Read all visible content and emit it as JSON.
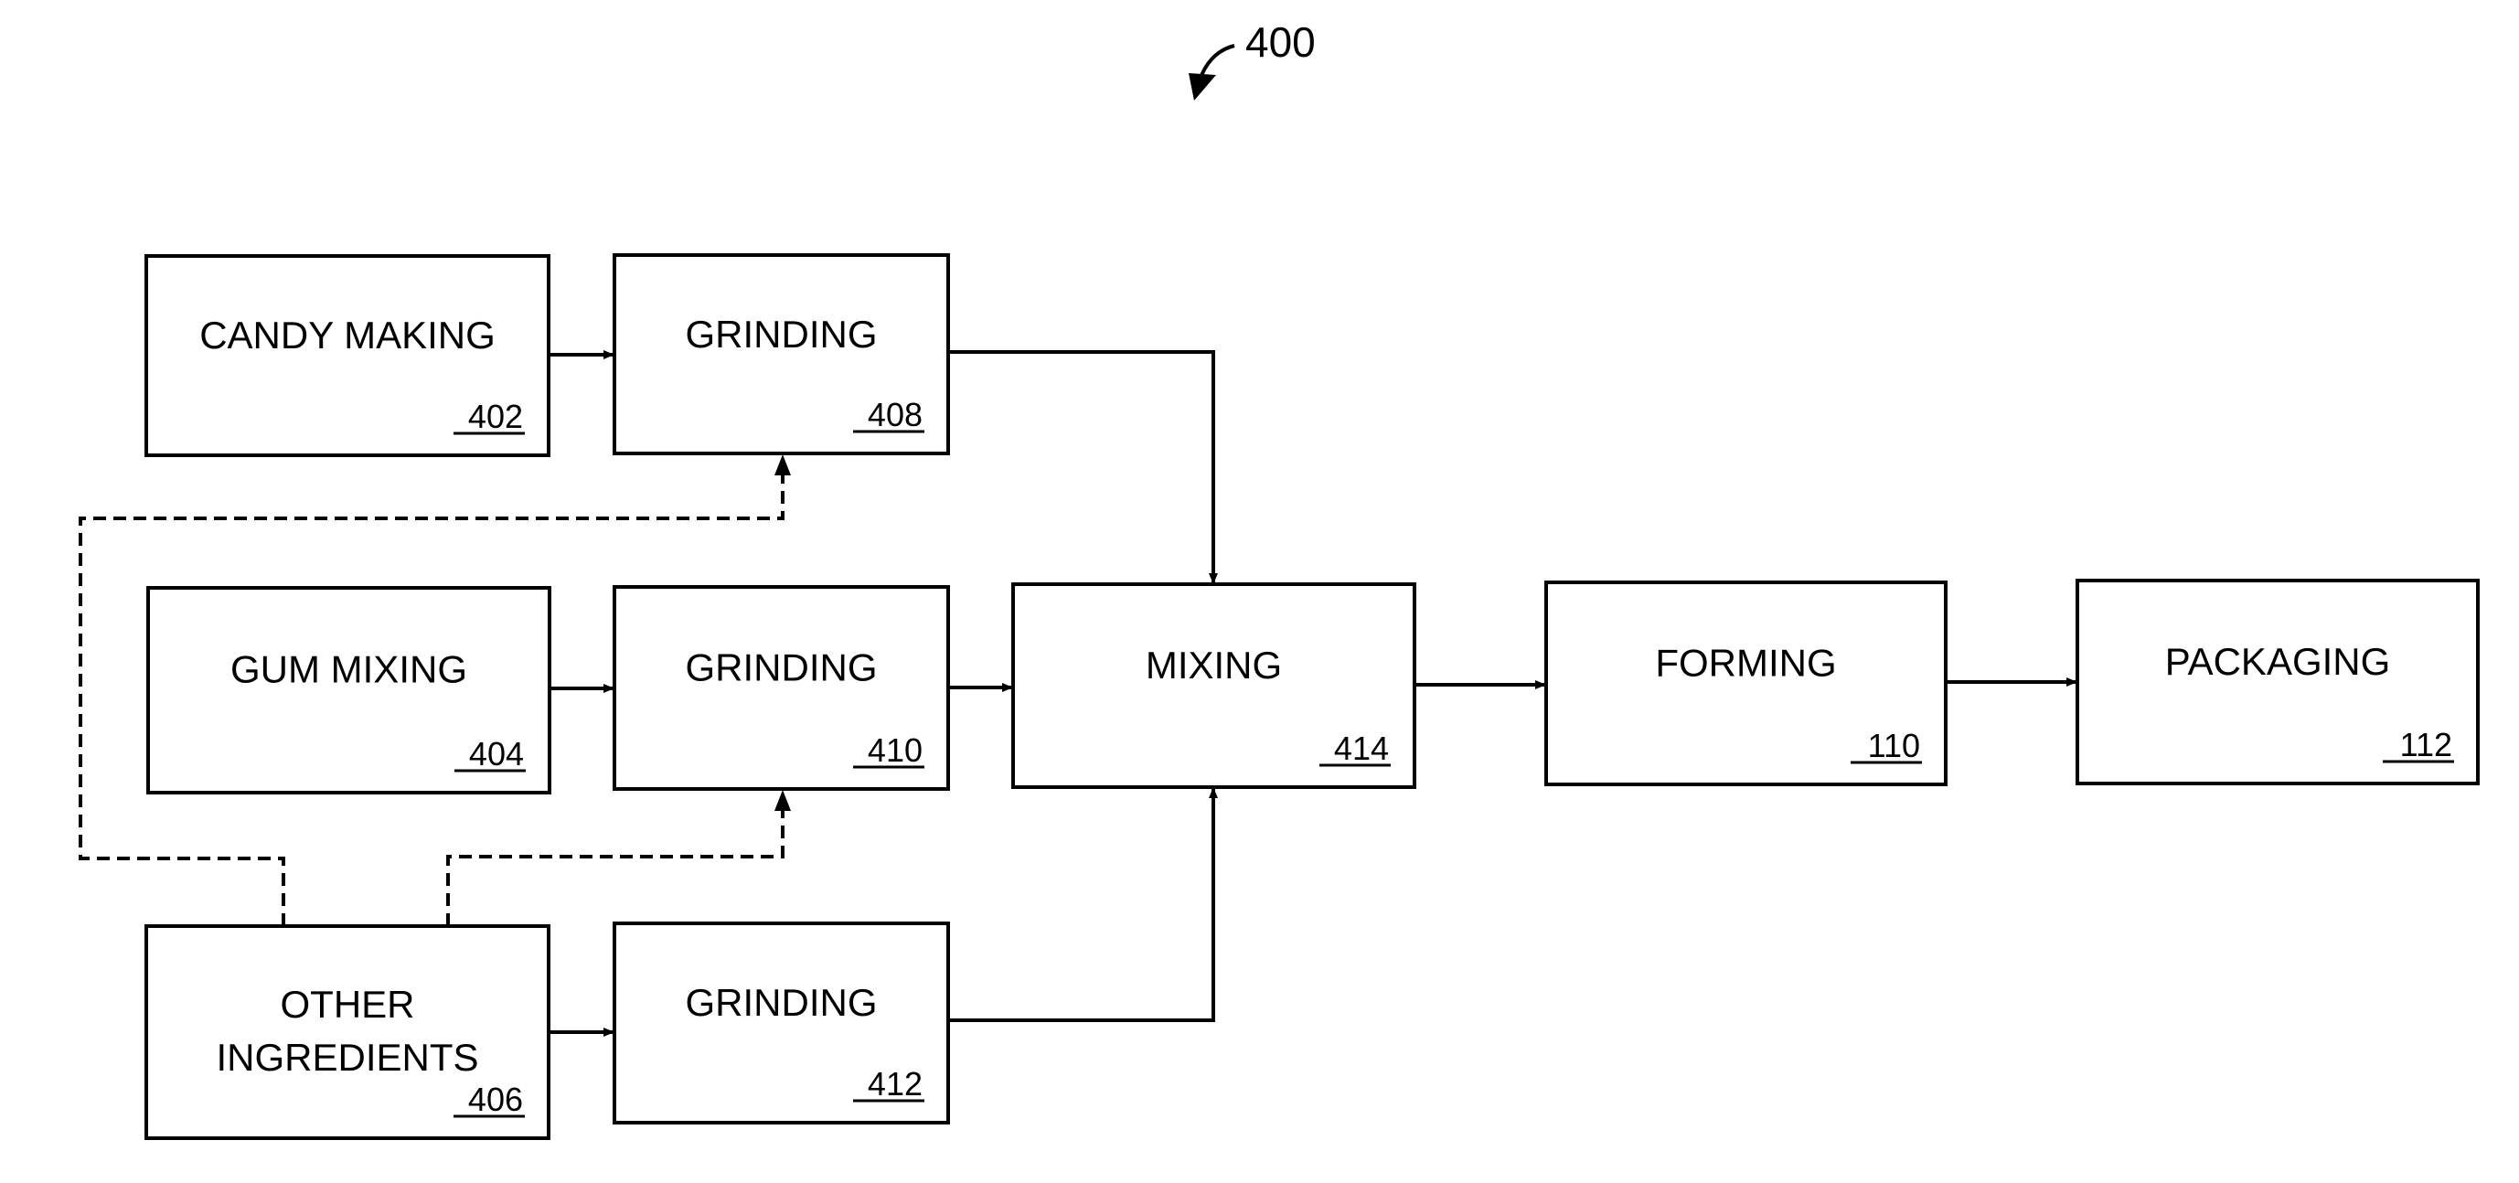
{
  "figure": {
    "label": "400"
  },
  "boxes": [
    {
      "id": "candy-making",
      "title": [
        "CANDY MAKING"
      ],
      "ref": "402"
    },
    {
      "id": "grinding-408",
      "title": [
        "GRINDING"
      ],
      "ref": "408"
    },
    {
      "id": "gum-mixing",
      "title": [
        "GUM MIXING"
      ],
      "ref": "404"
    },
    {
      "id": "grinding-410",
      "title": [
        "GRINDING"
      ],
      "ref": "410"
    },
    {
      "id": "other-ingredients",
      "title": [
        "OTHER",
        "INGREDIENTS"
      ],
      "ref": "406"
    },
    {
      "id": "grinding-412",
      "title": [
        "GRINDING"
      ],
      "ref": "412"
    },
    {
      "id": "mixing",
      "title": [
        "MIXING"
      ],
      "ref": "414"
    },
    {
      "id": "forming",
      "title": [
        "FORMING"
      ],
      "ref": "110"
    },
    {
      "id": "packaging",
      "title": [
        "PACKAGING"
      ],
      "ref": "112"
    }
  ],
  "connections": [
    {
      "from": "candy-making",
      "to": "grinding-408",
      "style": "solid"
    },
    {
      "from": "gum-mixing",
      "to": "grinding-410",
      "style": "solid"
    },
    {
      "from": "other-ingredients",
      "to": "grinding-412",
      "style": "solid"
    },
    {
      "from": "grinding-408",
      "to": "mixing",
      "style": "solid"
    },
    {
      "from": "grinding-410",
      "to": "mixing",
      "style": "solid"
    },
    {
      "from": "grinding-412",
      "to": "mixing",
      "style": "solid"
    },
    {
      "from": "mixing",
      "to": "forming",
      "style": "solid"
    },
    {
      "from": "forming",
      "to": "packaging",
      "style": "solid"
    },
    {
      "from": "other-ingredients",
      "to": "grinding-408",
      "style": "dashed"
    },
    {
      "from": "other-ingredients",
      "to": "grinding-410",
      "style": "dashed"
    }
  ]
}
